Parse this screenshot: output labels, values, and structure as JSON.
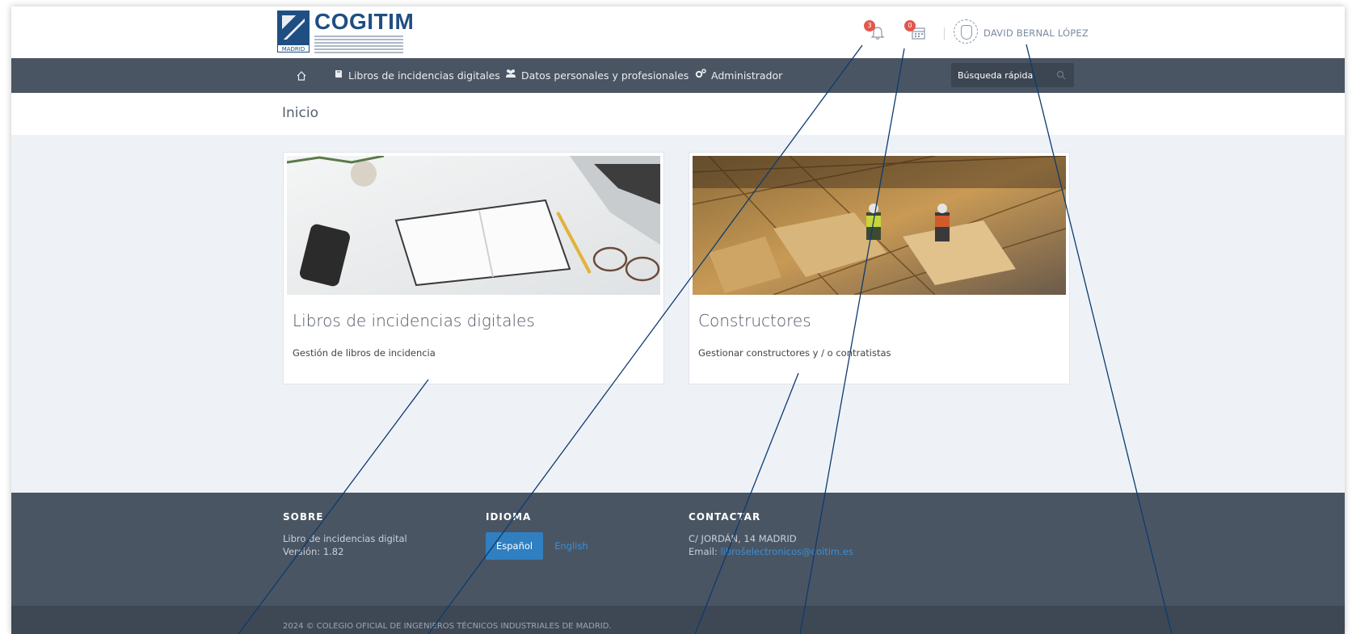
{
  "header": {
    "logo_text": "COGITIM",
    "logo_badge": "MADRID",
    "notifications_count": "3",
    "tasks_count": "0",
    "username": "DAVID BERNAL LÓPEZ"
  },
  "nav": {
    "home_icon": "home-icon",
    "items": [
      {
        "label": "Libros de incidencias digitales",
        "icon": "book-icon"
      },
      {
        "label": "Datos personales y profesionales",
        "icon": "users-icon"
      },
      {
        "label": "Administrador",
        "icon": "gears-icon"
      }
    ],
    "search_placeholder": "Búsqueda rápida"
  },
  "page": {
    "title": "Inicio"
  },
  "cards": [
    {
      "title": "Libros de incidencias digitales",
      "description": "Gestión de libros de incidencia"
    },
    {
      "title": "Constructores",
      "description": "Gestionar constructores y / o contratistas"
    }
  ],
  "footer": {
    "about_heading": "SOBRE",
    "about_line1": "Libro de incidencias digital",
    "about_line2": "Versión: 1.82",
    "lang_heading": "IDIOMA",
    "lang_es": "Español",
    "lang_en": "English",
    "contact_heading": "CONTACTAR",
    "contact_address": "C/ JORDÁN, 14 MADRID",
    "contact_email_label": "Email: ",
    "contact_email": "librošelectronicos@coitim.es",
    "copyright": "2024 © COLEGIO OFICIAL DE INGENIEROS TÉCNICOS INDUSTRIALES DE MADRID."
  },
  "colors": {
    "navbar": "#4a5563",
    "accent": "#2f7fc1",
    "badge": "#e2574c",
    "annotation_line": "#0c3b6e"
  }
}
